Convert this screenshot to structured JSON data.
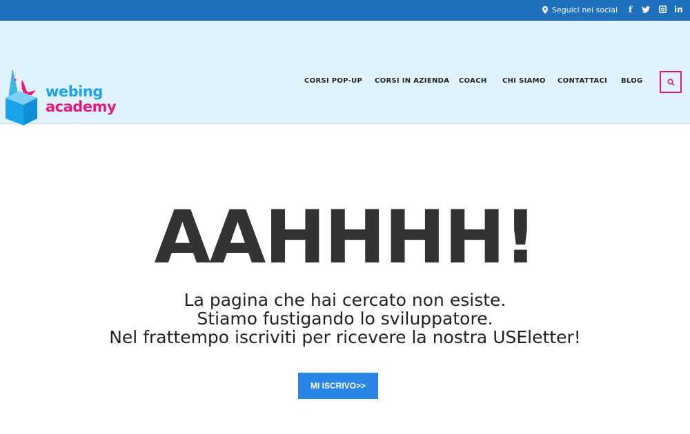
{
  "topbar": {
    "social_label": "Seguici nei social",
    "icons": [
      "location-pin-icon",
      "facebook-icon",
      "twitter-icon",
      "instagram-icon",
      "linkedin-icon"
    ],
    "social": {
      "facebook": "f",
      "linkedin": "in"
    }
  },
  "logo": {
    "line1": "webing",
    "line2": "academy"
  },
  "nav": {
    "items": [
      "CORSI POP-UP",
      "CORSI IN AZIENDA",
      "COACH",
      "CHI SIAMO",
      "CONTATTACI",
      "BLOG"
    ]
  },
  "main": {
    "heading": "AAHHHH!",
    "lines": [
      "La pagina che hai cercato non esiste.",
      "Stiamo fustigando lo sviluppatore.",
      "Nel frattempo iscriviti per ricevere la nostra USEletter!"
    ],
    "button": "MI ISCRIVO>>"
  },
  "colors": {
    "topbar": "#1f70bd",
    "header": "#e0f3fd",
    "accent_pink": "#e6177f",
    "accent_blue": "#1aa3e8",
    "button": "#2a86e6"
  }
}
